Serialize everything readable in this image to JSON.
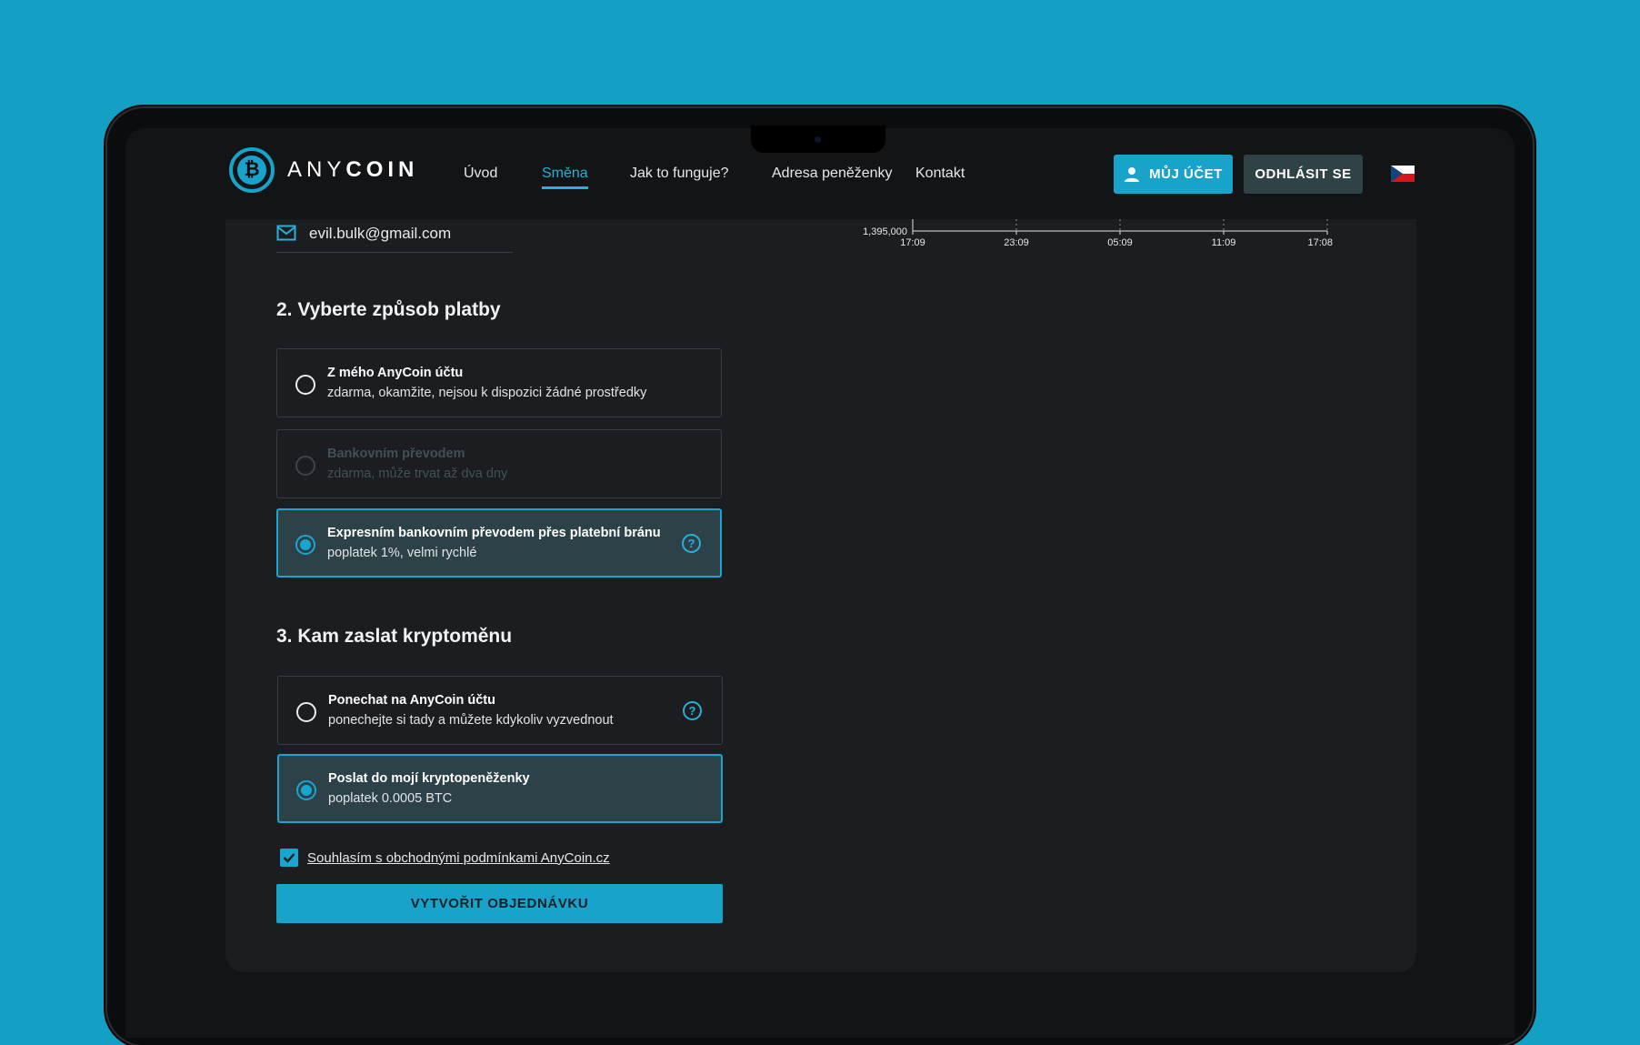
{
  "brand": {
    "name_light": "ANY",
    "name_bold": "COIN",
    "logo_symbol": "₿"
  },
  "nav": {
    "links": [
      "Úvod",
      "Směna",
      "Jak to funguje?",
      "Adresa peněženky",
      "Kontakt"
    ],
    "active": "Směna",
    "account_label": "MŮJ ÚČET",
    "logout_label": "ODHLÁSIT SE",
    "language_flag": "cz-flag-icon"
  },
  "email": {
    "value": "evil.bulk@gmail.com",
    "icon": "mail-icon"
  },
  "chart_data": {
    "type": "line",
    "x_ticks": [
      "17:09",
      "23:09",
      "05:09",
      "11:09",
      "17:08"
    ],
    "y_ticks": [
      "1,395,000"
    ],
    "series": []
  },
  "payment": {
    "title": "2. Vyberte způsob platby",
    "options": [
      {
        "title": "Z mého AnyCoin účtu",
        "desc": "zdarma, okamžite, nejsou k dispozici žádné prostředky",
        "state": "enabled",
        "selected": false
      },
      {
        "title": "Bankovním převodem",
        "desc": "zdarma, může trvat až dva dny",
        "state": "disabled",
        "selected": false
      },
      {
        "title": "Expresním bankovním převodem přes platební bránu",
        "desc": "poplatek 1%, velmi rychlé",
        "state": "enabled",
        "selected": true
      }
    ]
  },
  "delivery": {
    "title": "3. Kam zaslat kryptoměnu",
    "options": [
      {
        "title": "Ponechat na AnyCoin účtu",
        "desc": "ponechejte si tady a můžete kdykoliv vyzvednout",
        "selected": false
      },
      {
        "title": "Poslat do mojí kryptopeněženky",
        "desc": "poplatek 0.0005 BTC",
        "selected": true
      }
    ]
  },
  "help_symbol": "?",
  "agreement": {
    "label": "Souhlasím s obchodnými podmínkami AnyCoin.cz",
    "checked": true
  },
  "submit": {
    "label": "VYTVOŘIT OBJEDNÁVKU"
  },
  "colors": {
    "accent": "#18a3cb",
    "background": "#14a0c4",
    "panel": "#1b1d20",
    "selected_bg": "#2c4248"
  }
}
